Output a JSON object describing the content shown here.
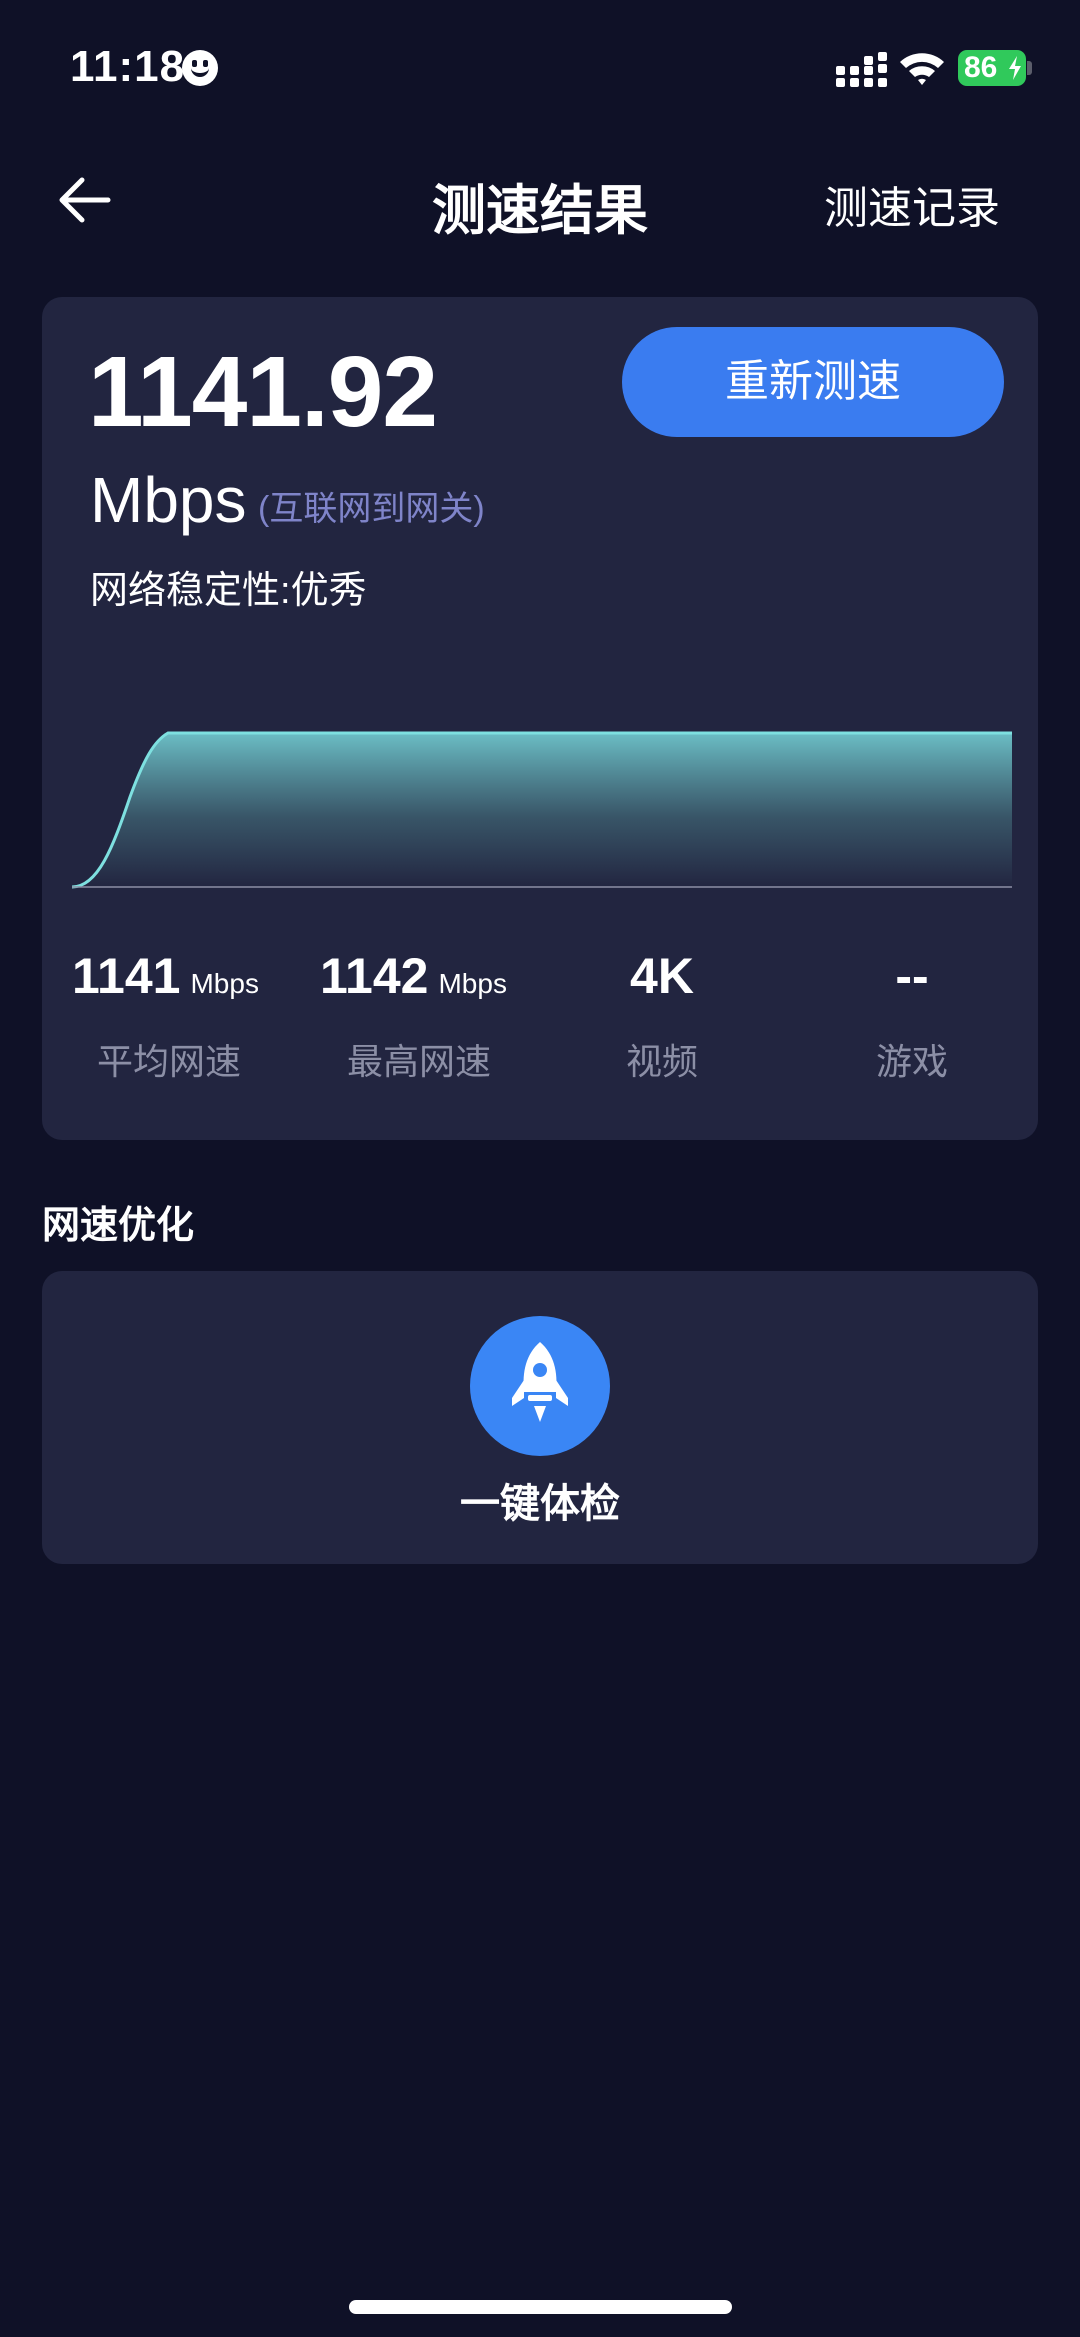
{
  "status_bar": {
    "time": "11:18",
    "battery": "86"
  },
  "nav": {
    "title": "测速结果",
    "history_label": "测速记录"
  },
  "result": {
    "speed_value": "1141.92",
    "speed_unit": "Mbps",
    "scope_note": "(互联网到网关)",
    "stability_label": "网络稳定性:",
    "stability_value": "优秀",
    "retest_label": "重新测速",
    "metrics": [
      {
        "value": "1141",
        "unit": "Mbps",
        "label": "平均网速"
      },
      {
        "value": "1142",
        "unit": "Mbps",
        "label": "最高网速"
      },
      {
        "value": "4K",
        "unit": "",
        "label": "视频"
      },
      {
        "value": "--",
        "unit": "",
        "label": "游戏"
      }
    ],
    "chart_color": "#6fd6d8"
  },
  "optimize": {
    "section_title": "网速优化",
    "checkup_label": "一键体检",
    "accent_color": "#3a86f5"
  }
}
